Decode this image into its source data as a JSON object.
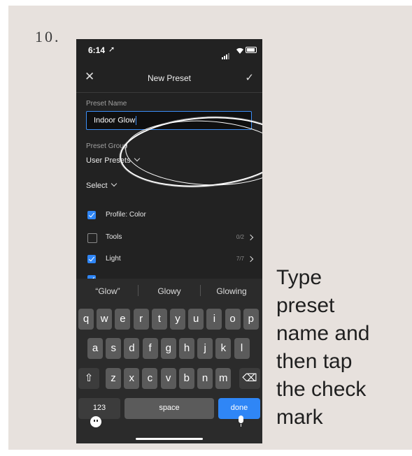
{
  "step_number": "10.",
  "status_bar": {
    "time": "6:14"
  },
  "navbar": {
    "close": "✕",
    "title": "New Preset",
    "check": "✓"
  },
  "preset_name": {
    "label": "Preset Name",
    "value": "Indoor Glow"
  },
  "preset_group": {
    "label": "Preset Group",
    "value": "User Presets"
  },
  "select_label": "Select",
  "rows": [
    {
      "label": "Profile: Color",
      "checked": true,
      "count": ""
    },
    {
      "label": "Tools",
      "checked": false,
      "count": "0/2"
    },
    {
      "label": "Light",
      "checked": true,
      "count": "7/7"
    }
  ],
  "suggestions": [
    "“Glow”",
    "Glowy",
    "Glowing"
  ],
  "keys": {
    "row1": [
      "q",
      "w",
      "e",
      "r",
      "t",
      "y",
      "u",
      "i",
      "o",
      "p"
    ],
    "row2": [
      "a",
      "s",
      "d",
      "f",
      "g",
      "h",
      "j",
      "k",
      "l"
    ],
    "row3": [
      "z",
      "x",
      "c",
      "v",
      "b",
      "n",
      "m"
    ],
    "shift": "⇧",
    "delete": "⌫",
    "num": "123",
    "space": "space",
    "done": "done"
  },
  "caption": [
    "Type",
    "preset",
    "name and",
    "then tap",
    "the check",
    "mark"
  ],
  "colors": {
    "accent": "#2f86f6",
    "background": "#e7e1dd",
    "phone": "#222222"
  }
}
